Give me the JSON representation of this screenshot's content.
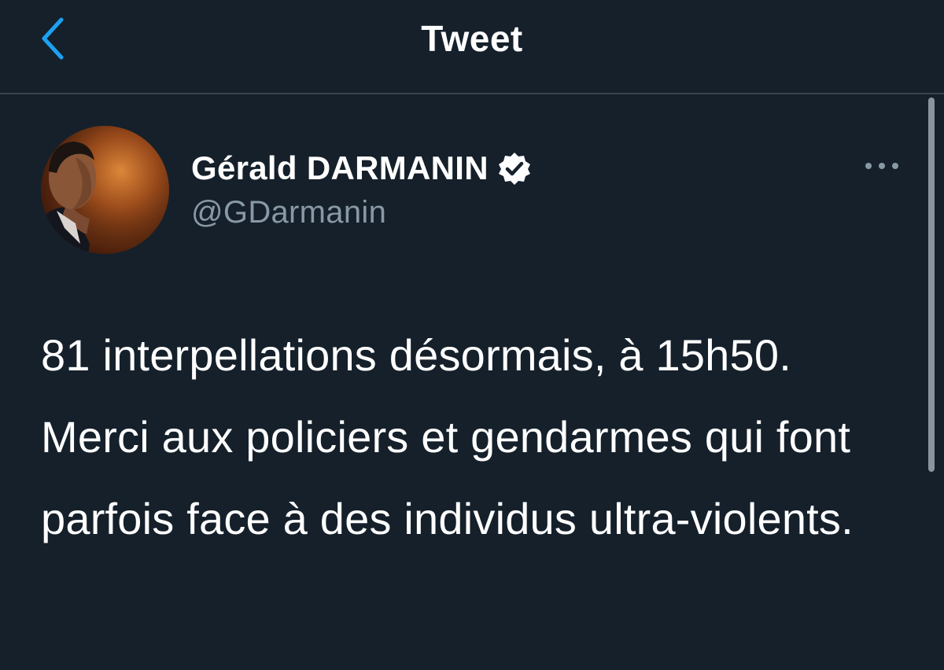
{
  "header": {
    "title": "Tweet",
    "back_icon": "chevron-left-icon"
  },
  "tweet": {
    "author_name": "Gérald DARMANIN",
    "handle": "@GDarmanin",
    "verified_icon": "verified-badge-icon",
    "more_icon": "more-options-icon",
    "text": "81 interpellations désormais, à 15h50. Merci aux policiers et gendarmes qui font parfois face à des individus ultra-violents."
  },
  "colors": {
    "background": "#15202b",
    "accent": "#1da1f2",
    "secondary_text": "#8899a6",
    "divider": "#38444d"
  }
}
